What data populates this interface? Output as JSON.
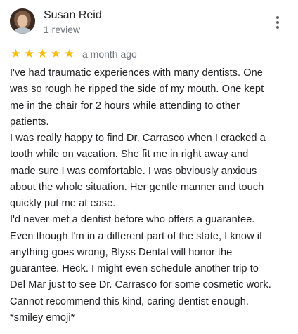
{
  "review": {
    "author": {
      "name": "Susan Reid",
      "meta": "1 review"
    },
    "rating": 5,
    "max_rating": 5,
    "date": "a month ago",
    "icons": {
      "star": "star-icon",
      "more": "more-vert-icon"
    },
    "colors": {
      "star": "#fbbc04",
      "text": "#202124",
      "muted": "#70757a"
    },
    "text_lines": [
      "I've had traumatic experiences with many dentists. One",
      "was so rough he ripped the side of my mouth. One kept",
      "me in the chair for 2 hours while attending to other",
      "patients.",
      "I was really happy to find Dr. Carrasco when I cracked a",
      "tooth while on vacation. She fit me in right away and",
      "made sure I was comfortable. I was obviously anxious",
      "about the whole situation. Her gentle manner and touch",
      "quickly put me at ease.",
      "I'd never met a dentist before who offers a guarantee.",
      "Even though I'm in a different part of the state, I know if",
      "anything goes wrong, Blyss Dental will honor the",
      "guarantee. Heck. I might even schedule another trip to",
      "Del Mar just to see Dr. Carrasco for some cosmetic work.",
      "Cannot recommend this kind, caring dentist enough.",
      "*smiley emoji*"
    ]
  }
}
